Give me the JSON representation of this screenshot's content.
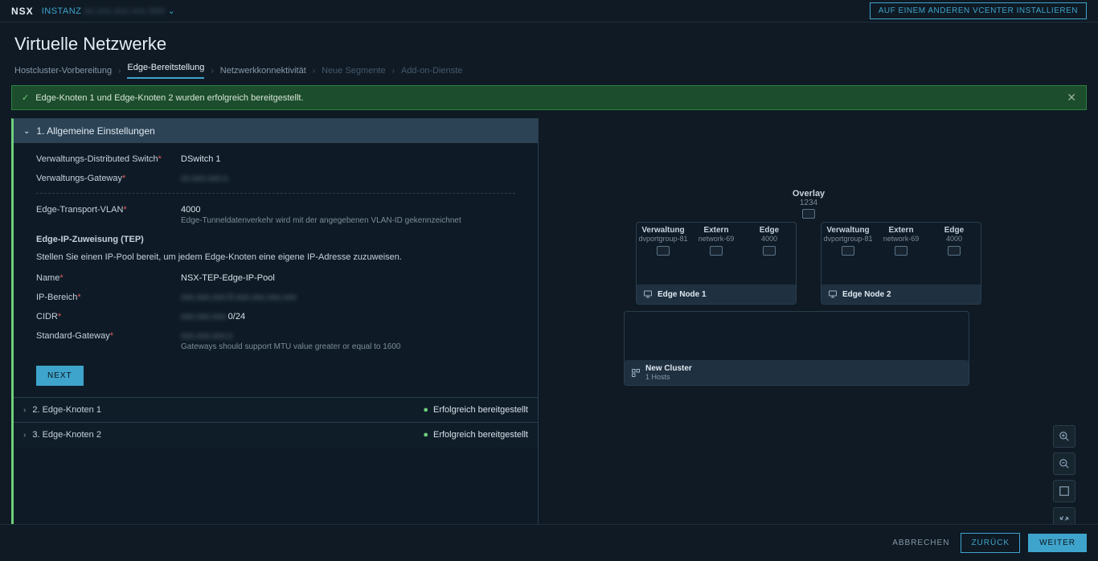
{
  "topbar": {
    "logo": "NSX",
    "instanz_label": "INSTANZ",
    "instanz_ip": "xx.xxx.xxx.xxx:443",
    "install_btn": "AUF EINEM ANDEREN VCENTER INSTALLIEREN"
  },
  "page_title": "Virtuelle Netzwerke",
  "breadcrumb": {
    "items": [
      {
        "label": "Hostcluster-Vorbereitung",
        "state": "done"
      },
      {
        "label": "Edge-Bereitstellung",
        "state": "active"
      },
      {
        "label": "Netzwerkkonnektivität",
        "state": "next"
      },
      {
        "label": "Neue Segmente",
        "state": "disabled"
      },
      {
        "label": "Add-on-Dienste",
        "state": "disabled"
      }
    ]
  },
  "alert": {
    "text": "Edge-Knoten 1 und Edge-Knoten 2 wurden erfolgreich bereitgestellt."
  },
  "accordion": {
    "section1": {
      "title": "1. Allgemeine Einstellungen",
      "fields": {
        "vds_label": "Verwaltungs-Distributed Switch",
        "vds_value": "DSwitch 1",
        "gateway_label": "Verwaltungs-Gateway",
        "gateway_value": "xx.xxx.xxx.x",
        "vlan_label": "Edge-Transport-VLAN",
        "vlan_value": "4000",
        "vlan_hint": "Edge-Tunneldatenverkehr wird mit der angegebenen VLAN-ID gekennzeichnet",
        "tep_title": "Edge-IP-Zuweisung (TEP)",
        "tep_desc": "Stellen Sie einen IP-Pool bereit, um jedem Edge-Knoten eine eigene IP-Adresse zuzuweisen.",
        "name_label": "Name",
        "name_value": "NSX-TEP-Edge-IP-Pool",
        "range_label": "IP-Bereich",
        "range_value": "xxx.xxx.xxx.5-xxx.xxx.xxx.xxx",
        "cidr_label": "CIDR",
        "cidr_value": "xxx.xxx.xxx.0/24",
        "std_gw_label": "Standard-Gateway",
        "std_gw_value": "xxx.xxx.xxx.x",
        "std_gw_hint": "Gateways should support MTU value greater or equal to 1600",
        "next_btn": "NEXT"
      }
    },
    "section2": {
      "title": "2. Edge-Knoten 1",
      "status": "Erfolgreich bereitgestellt"
    },
    "section3": {
      "title": "3. Edge-Knoten 2",
      "status": "Erfolgreich bereitgestellt"
    }
  },
  "diagram": {
    "overlay_label": "Overlay",
    "overlay_id": "1234",
    "cols": {
      "verwaltung": "Verwaltung",
      "verwaltung_sub": "dvportgroup-81",
      "extern": "Extern",
      "extern_sub": "network-69",
      "edge": "Edge",
      "edge_sub": "4000"
    },
    "node1": "Edge Node 1",
    "node2": "Edge Node 2",
    "cluster_name": "New Cluster",
    "cluster_hosts": "1 Hosts"
  },
  "footer": {
    "cancel": "ABBRECHEN",
    "back": "ZURÜCK",
    "next": "WEITER"
  }
}
